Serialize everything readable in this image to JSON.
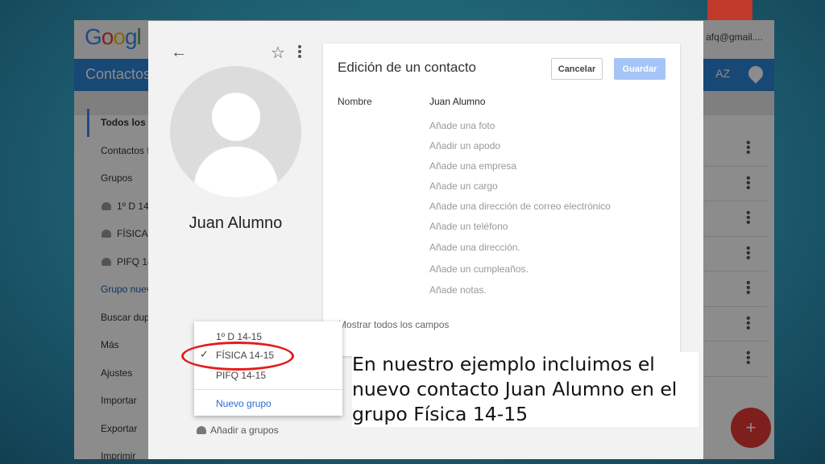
{
  "background_app": {
    "logo": [
      "G",
      "o",
      "o",
      "g",
      "l"
    ],
    "user_email": "afq@gmail....",
    "app_title": "Contactos",
    "sort_label": "AZ",
    "sidebar": [
      {
        "label": "Todos los c",
        "kind": "active"
      },
      {
        "label": "Contactos f",
        "kind": "plain"
      },
      {
        "label": "Grupos",
        "kind": "plain"
      },
      {
        "label": "1º D 14",
        "kind": "group"
      },
      {
        "label": "FÍSICA",
        "kind": "group"
      },
      {
        "label": "PIFQ 14",
        "kind": "group"
      },
      {
        "label": "Grupo nuev",
        "kind": "link"
      },
      {
        "label": "Buscar dup",
        "kind": "plain"
      },
      {
        "label": "Más",
        "kind": "plain"
      },
      {
        "label": "Ajustes",
        "kind": "plain"
      },
      {
        "label": "Importar",
        "kind": "plain"
      },
      {
        "label": "Exportar",
        "kind": "plain"
      },
      {
        "label": "Imprimir",
        "kind": "plain"
      }
    ],
    "row_count": 7
  },
  "dialog": {
    "contact_name": "Juan Alumno",
    "edit_card": {
      "title": "Edición de un contacto",
      "cancel_label": "Cancelar",
      "save_label": "Guardar",
      "name_label": "Nombre",
      "name_value": "Juan Alumno",
      "add_fields": [
        "Añade una foto",
        "Añadir un apodo",
        "Añade una empresa",
        "Añade un cargo",
        "Añade una dirección de correo electrónico",
        "Añade un teléfono",
        "Añade una dirección.",
        "Añade un cumpleaños.",
        "Añade notas."
      ],
      "show_all": "Mostrar todos los campos"
    },
    "groups_menu": {
      "items": [
        {
          "label": "1º D 14-15",
          "checked": false
        },
        {
          "label": "FÍSICA 14-15",
          "checked": true
        },
        {
          "label": "PIFQ 14-15",
          "checked": false
        }
      ],
      "check_glyph": "✓",
      "new_group": "Nuevo grupo"
    },
    "add_groups": "Añadir a grupos"
  },
  "caption": "En nuestro ejemplo incluimos el nuevo contacto Juan Alumno en el grupo Física 14-15",
  "colors": {
    "highlight": "#e41c1c",
    "primary_blue": "#2c84d8",
    "save_button": "#a6c4f5",
    "fab": "#e53935"
  }
}
